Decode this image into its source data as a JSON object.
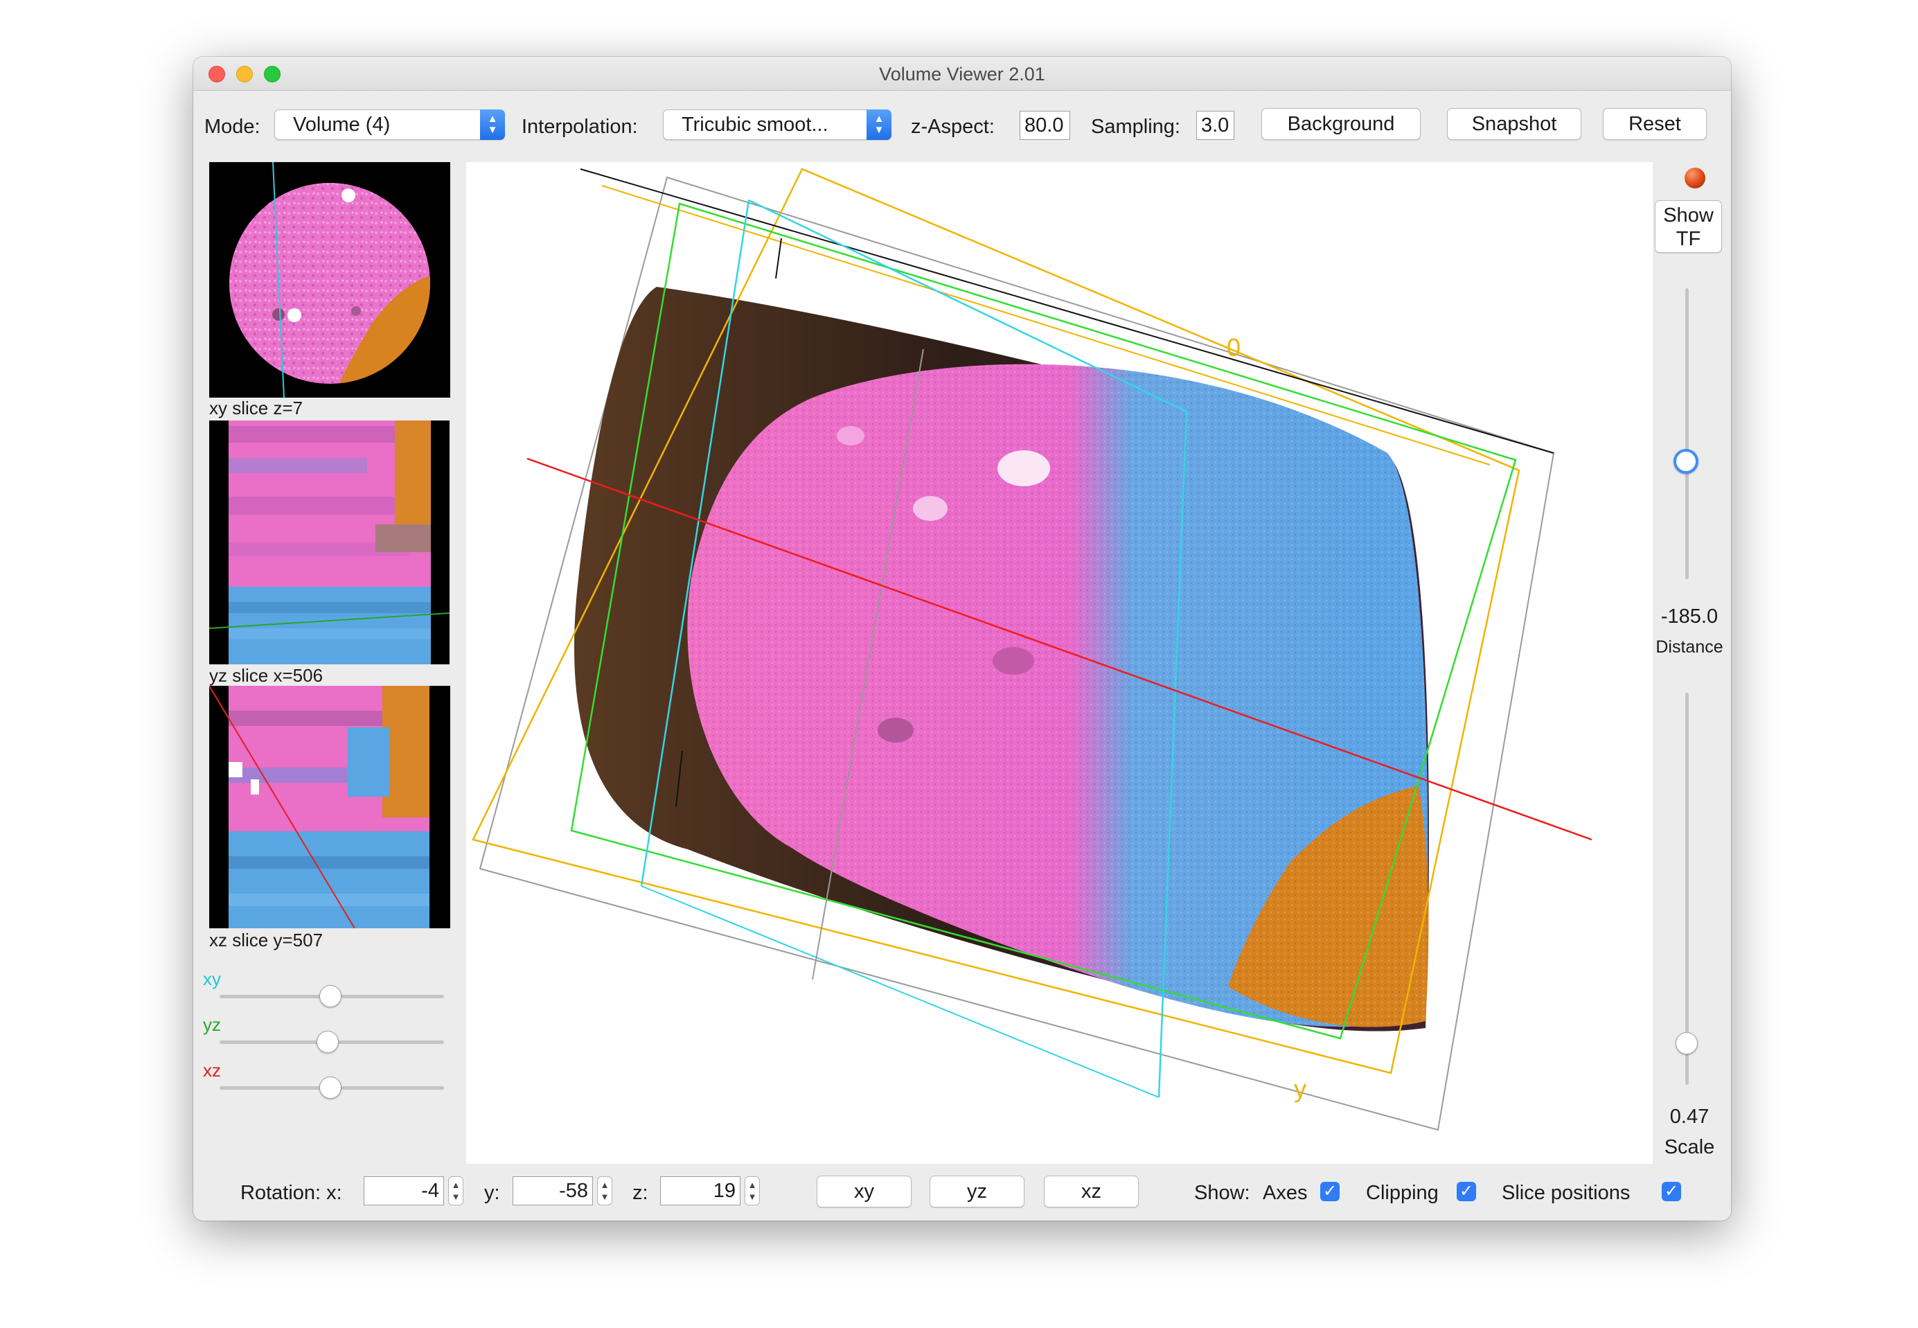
{
  "window": {
    "title": "Volume Viewer 2.01"
  },
  "toolbar": {
    "mode_label": "Mode:",
    "mode_value": "Volume (4)",
    "interp_label": "Interpolation:",
    "interp_value": "Tricubic smoot...",
    "zaspect_label": "z-Aspect:",
    "zaspect_value": "80.0",
    "sampling_label": "Sampling:",
    "sampling_value": "3.0",
    "background_button": "Background",
    "snapshot_button": "Snapshot",
    "reset_button": "Reset"
  },
  "slices": {
    "xy_caption": "xy slice   z=7",
    "yz_caption": "yz slice   x=506",
    "xz_caption": "xz slice   y=507"
  },
  "slice_sliders": {
    "xy_label": "xy",
    "yz_label": "yz",
    "xz_label": "xz",
    "xy_position": 0.5,
    "yz_position": 0.49,
    "xz_position": 0.5,
    "xy_color": "#1ec7d6",
    "yz_color": "#2aa62a",
    "xz_color": "#e02020"
  },
  "viewport": {
    "axis_label_0": "0",
    "axis_label_y": "y",
    "axis_label_color": "#f0b400",
    "box_colors": {
      "outer": "#999999",
      "yellow": "#f0b400",
      "green": "#33dd33",
      "cyan": "#33d5e5",
      "red": "#ee1c1c"
    },
    "volume_colors": {
      "pink": "#ee6cc6",
      "blue": "#5fa8e6",
      "orange": "#d6801e",
      "dark": "#3b2418"
    }
  },
  "right_panel": {
    "show_tf_line1": "Show",
    "show_tf_line2": "TF",
    "distance_value": "-185.0",
    "distance_label": "Distance",
    "distance_position": 0.6,
    "scale_value": "0.47",
    "scale_label": "Scale",
    "scale_position": 0.1
  },
  "bottom": {
    "rotation_label": "Rotation:  x:",
    "rot_x": "-4",
    "y_label": "y:",
    "rot_y": "-58",
    "z_label": "z:",
    "rot_z": "19",
    "xy_button": "xy",
    "yz_button": "yz",
    "xz_button": "xz",
    "show_label": "Show:",
    "axes_label": "Axes",
    "axes_checked": true,
    "clipping_label": "Clipping",
    "clipping_checked": true,
    "slice_positions_label": "Slice positions",
    "slice_positions_checked": true
  }
}
